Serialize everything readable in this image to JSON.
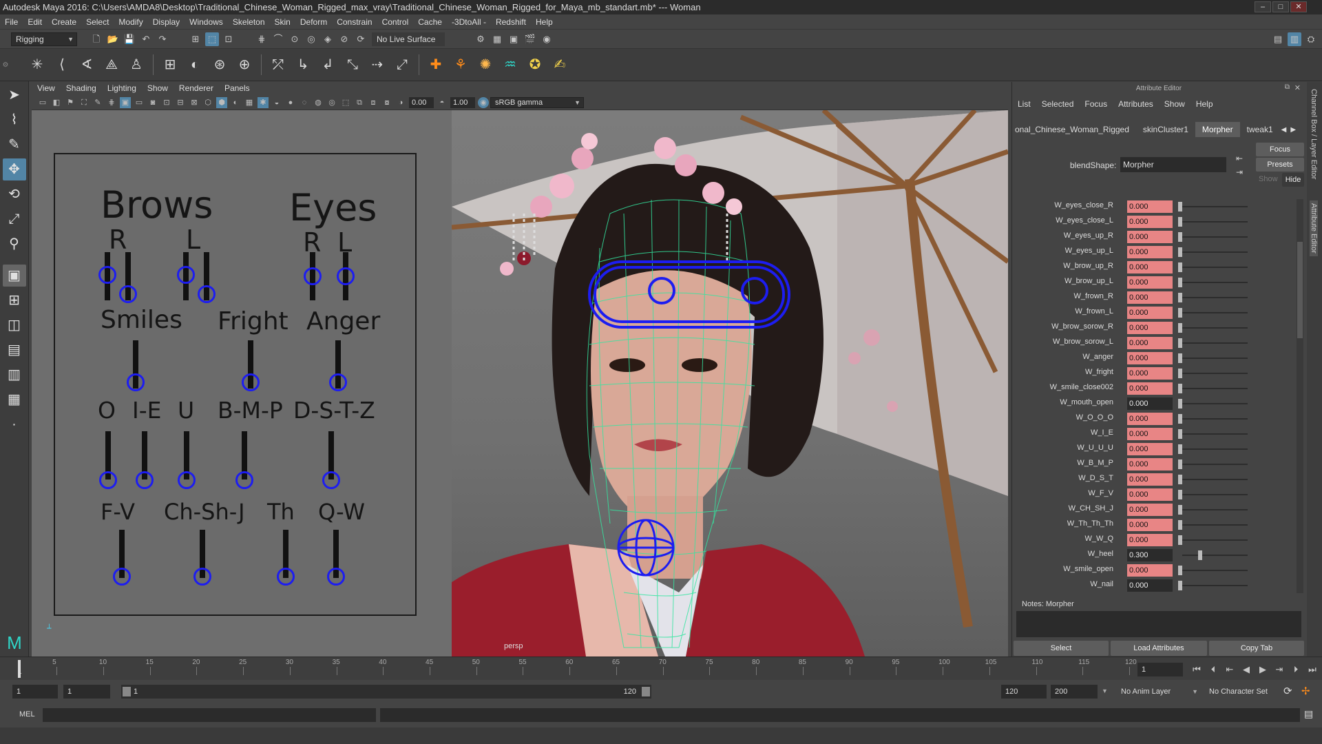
{
  "window": {
    "title": "Autodesk Maya 2016: C:\\Users\\AMDA8\\Desktop\\Traditional_Chinese_Woman_Rigged_max_vray\\Traditional_Chinese_Woman_Rigged_for_Maya_mb_standart.mb*",
    "title_suffix": "---   Woman"
  },
  "menubar": [
    "File",
    "Edit",
    "Create",
    "Select",
    "Modify",
    "Display",
    "Windows",
    "Skeleton",
    "Skin",
    "Deform",
    "Constrain",
    "Control",
    "Cache",
    "-3DtoAll -",
    "Redshift",
    "Help"
  ],
  "statusline": {
    "menuset": "Rigging",
    "live_surface": "No Live Surface"
  },
  "panel_menu": [
    "View",
    "Shading",
    "Lighting",
    "Show",
    "Renderer",
    "Panels"
  ],
  "panel_toolbar": {
    "value_a": "0.00",
    "value_b": "1.00",
    "color_space": "sRGB gamma"
  },
  "viewport": {
    "camera_label": "persp"
  },
  "face_panel": {
    "headers": {
      "brows": "Brows",
      "eyes": "Eyes"
    },
    "brow_labels": [
      "R",
      "L"
    ],
    "eye_labels": [
      "R",
      "L"
    ],
    "emotions": [
      "Smiles",
      "Fright",
      "Anger"
    ],
    "visemes_row1": [
      "O",
      "I-E",
      "U",
      "B-M-P",
      "D-S-T-Z"
    ],
    "visemes_row2": [
      "F-V",
      "Ch-Sh-J",
      "Th",
      "Q-W"
    ]
  },
  "attribute_editor": {
    "title": "Attribute Editor",
    "menu": [
      "List",
      "Selected",
      "Focus",
      "Attributes",
      "Show",
      "Help"
    ],
    "tabs": [
      "onal_Chinese_Woman_Rigged",
      "skinCluster1",
      "Morpher",
      "tweak1"
    ],
    "selected_tab": "Morpher",
    "blendshape_label": "blendShape:",
    "blendshape_value": "Morpher",
    "focus_label": "Focus",
    "presets_label": "Presets",
    "show_label": "Show",
    "hide_label": "Hide",
    "attributes": [
      {
        "name": "W_eyes_close_R",
        "value": "0.000",
        "keyed": true,
        "slider": 0.0
      },
      {
        "name": "W_eyes_close_L",
        "value": "0.000",
        "keyed": true,
        "slider": 0.0
      },
      {
        "name": "W_eyes_up_R",
        "value": "0.000",
        "keyed": true,
        "slider": 0.0
      },
      {
        "name": "W_eyes_up_L",
        "value": "0.000",
        "keyed": true,
        "slider": 0.0
      },
      {
        "name": "W_brow_up_R",
        "value": "0.000",
        "keyed": true,
        "slider": 0.0
      },
      {
        "name": "W_brow_up_L",
        "value": "0.000",
        "keyed": true,
        "slider": 0.0
      },
      {
        "name": "W_frown_R",
        "value": "0.000",
        "keyed": true,
        "slider": 0.0
      },
      {
        "name": "W_frown_L",
        "value": "0.000",
        "keyed": true,
        "slider": 0.0
      },
      {
        "name": "W_brow_sorow_R",
        "value": "0.000",
        "keyed": true,
        "slider": 0.0
      },
      {
        "name": "W_brow_sorow_L",
        "value": "0.000",
        "keyed": true,
        "slider": 0.0
      },
      {
        "name": "W_anger",
        "value": "0.000",
        "keyed": true,
        "slider": 0.0
      },
      {
        "name": "W_fright",
        "value": "0.000",
        "keyed": true,
        "slider": 0.0
      },
      {
        "name": "W_smile_close002",
        "value": "0.000",
        "keyed": true,
        "slider": 0.0
      },
      {
        "name": "W_mouth_open",
        "value": "0.000",
        "keyed": false,
        "slider": 0.0
      },
      {
        "name": "W_O_O_O",
        "value": "0.000",
        "keyed": true,
        "slider": 0.0
      },
      {
        "name": "W_I_E",
        "value": "0.000",
        "keyed": true,
        "slider": 0.0
      },
      {
        "name": "W_U_U_U",
        "value": "0.000",
        "keyed": true,
        "slider": 0.0
      },
      {
        "name": "W_B_M_P",
        "value": "0.000",
        "keyed": true,
        "slider": 0.0
      },
      {
        "name": "W_D_S_T",
        "value": "0.000",
        "keyed": true,
        "slider": 0.0
      },
      {
        "name": "W_F_V",
        "value": "0.000",
        "keyed": true,
        "slider": 0.0
      },
      {
        "name": "W_CH_SH_J",
        "value": "0.000",
        "keyed": true,
        "slider": 0.0
      },
      {
        "name": "W_Th_Th_Th",
        "value": "0.000",
        "keyed": true,
        "slider": 0.0
      },
      {
        "name": "W_W_Q",
        "value": "0.000",
        "keyed": true,
        "slider": 0.0
      },
      {
        "name": "W_heel",
        "value": "0.300",
        "keyed": false,
        "slider": 0.3
      },
      {
        "name": "W_smile_open",
        "value": "0.000",
        "keyed": true,
        "slider": 0.0
      },
      {
        "name": "W_nail",
        "value": "0.000",
        "keyed": false,
        "slider": 0.0
      }
    ],
    "notes_label": "Notes:",
    "notes_value": "Morpher",
    "bottom_buttons": [
      "Select",
      "Load Attributes",
      "Copy Tab"
    ]
  },
  "side_tabs": [
    "Channel Box / Layer Editor",
    "Attribute Editor"
  ],
  "timeline": {
    "ticks": [
      "5",
      "10",
      "15",
      "20",
      "25",
      "30",
      "35",
      "40",
      "45",
      "50",
      "55",
      "60",
      "65",
      "70",
      "75",
      "80",
      "85",
      "90",
      "95",
      "100",
      "105",
      "110",
      "115",
      "120"
    ],
    "start_tick": "1",
    "current_frame": "1"
  },
  "range": {
    "start": "1",
    "playback_start": "1",
    "slider_start": "1",
    "slider_end": "120",
    "playback_end": "120",
    "end": "200",
    "anim_layer": "No Anim Layer",
    "character_set": "No Character Set"
  },
  "command_line": {
    "label": "MEL"
  },
  "colors": {
    "keyed_field": "#e88585",
    "control_curve": "#1d1df0",
    "wireframe": "#33e6a0",
    "accent": "#5285a6"
  }
}
